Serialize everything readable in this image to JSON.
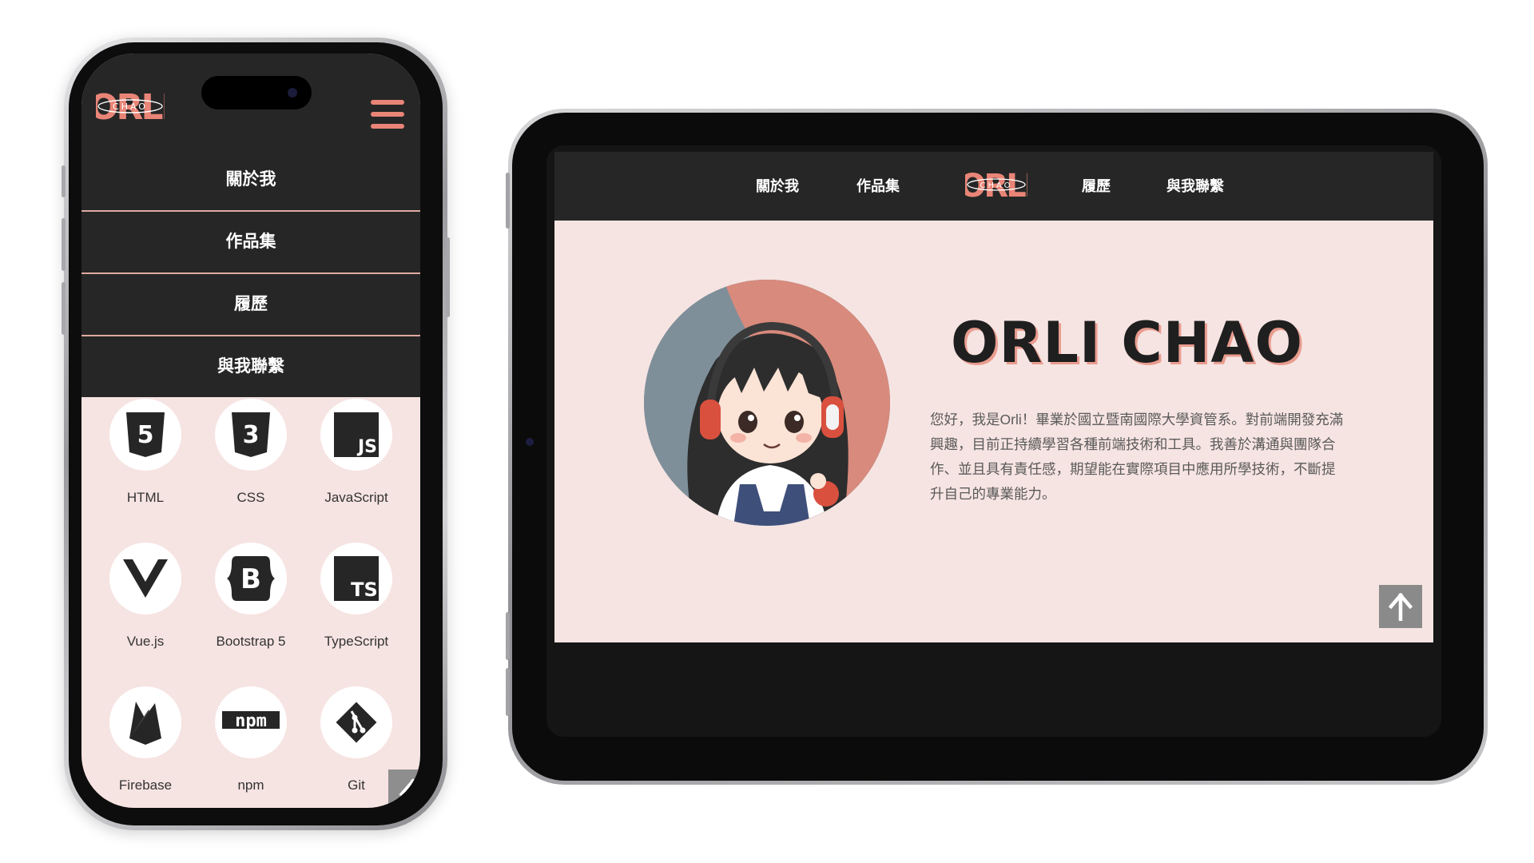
{
  "brand": {
    "logo_text": "ORLI",
    "logo_sub": "CHAO",
    "accent": "#e98577",
    "dark": "#262626",
    "page_bg": "#f6e4e2"
  },
  "phone": {
    "menu": [
      {
        "label": "關於我"
      },
      {
        "label": "作品集"
      },
      {
        "label": "履歷"
      },
      {
        "label": "與我聯繫"
      }
    ],
    "menu_icon": "hamburger-icon",
    "skills": [
      {
        "label": "HTML",
        "icon": "html5-icon"
      },
      {
        "label": "CSS",
        "icon": "css3-icon"
      },
      {
        "label": "JavaScript",
        "icon": "javascript-icon"
      },
      {
        "label": "Vue.js",
        "icon": "vue-icon"
      },
      {
        "label": "Bootstrap 5",
        "icon": "bootstrap-icon"
      },
      {
        "label": "TypeScript",
        "icon": "typescript-icon"
      },
      {
        "label": "Firebase",
        "icon": "firebase-icon"
      },
      {
        "label": "npm",
        "icon": "npm-icon"
      },
      {
        "label": "Git",
        "icon": "git-icon"
      }
    ],
    "skill_glyphs": {
      "html": "5",
      "css": "3",
      "js": "JS",
      "bootstrap": "B",
      "ts": "TS",
      "npm": "npm"
    },
    "back_to_top_icon": "arrow-up-icon"
  },
  "tablet": {
    "nav": {
      "about": "關於我",
      "portfolio": "作品集",
      "resume": "履歷",
      "contact": "與我聯繫"
    },
    "hero": {
      "name": "ORLI CHAO",
      "bio": "您好，我是Orli！畢業於國立暨南國際大學資管系。對前端開發充滿興趣，目前正持續學習各種前端技術和工具。我善於溝通與團隊合作、並且具有責任感，期望能在實際項目中應用所學技術，不斷提升自己的專業能力。"
    },
    "back_to_top_icon": "arrow-up-icon"
  }
}
